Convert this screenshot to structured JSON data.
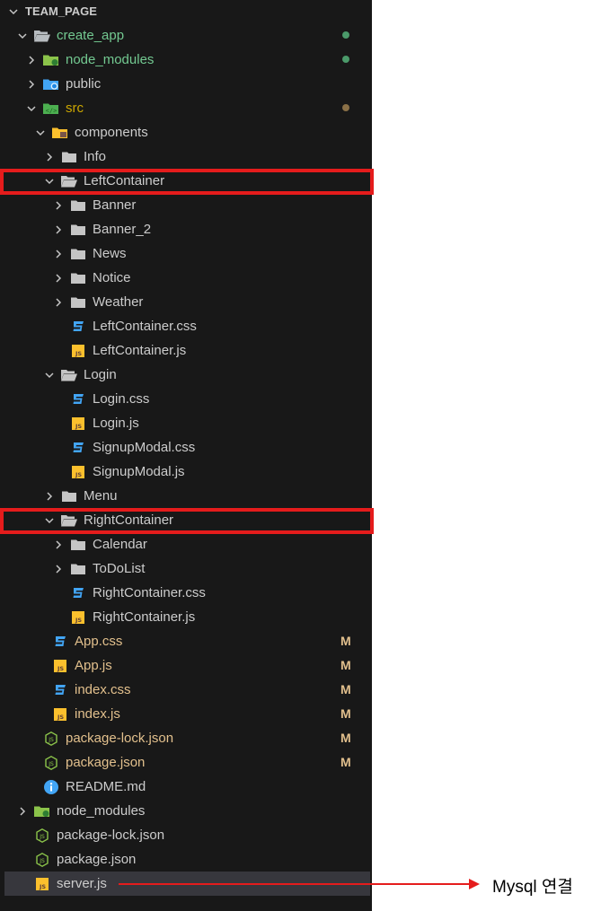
{
  "explorer": {
    "rows": [
      {
        "label": "TEAM_PAGE",
        "depth": 0,
        "chevron": "open",
        "icon": "none",
        "style": "root"
      },
      {
        "label": "create_app",
        "depth": 1,
        "chevron": "open",
        "icon": "folder-open-gray",
        "style": "green",
        "dot": "#4b9a6a"
      },
      {
        "label": "node_modules",
        "depth": 2,
        "chevron": "closed",
        "icon": "folder-node",
        "style": "green",
        "dot": "#4b9a6a"
      },
      {
        "label": "public",
        "depth": 2,
        "chevron": "closed",
        "icon": "folder-public",
        "style": "normal"
      },
      {
        "label": "src",
        "depth": 2,
        "chevron": "open",
        "icon": "folder-src",
        "style": "brown",
        "dot": "#8a7047"
      },
      {
        "label": "components",
        "depth": 3,
        "chevron": "open",
        "icon": "folder-components",
        "style": "normal"
      },
      {
        "label": "Info",
        "depth": 4,
        "chevron": "closed",
        "icon": "folder",
        "style": "normal"
      },
      {
        "label": "LeftContainer",
        "depth": 4,
        "chevron": "open",
        "icon": "folder-open",
        "style": "normal"
      },
      {
        "label": "Banner",
        "depth": 5,
        "chevron": "closed",
        "icon": "folder",
        "style": "normal"
      },
      {
        "label": "Banner_2",
        "depth": 5,
        "chevron": "closed",
        "icon": "folder",
        "style": "normal"
      },
      {
        "label": "News",
        "depth": 5,
        "chevron": "closed",
        "icon": "folder",
        "style": "normal"
      },
      {
        "label": "Notice",
        "depth": 5,
        "chevron": "closed",
        "icon": "folder",
        "style": "normal"
      },
      {
        "label": "Weather",
        "depth": 5,
        "chevron": "closed",
        "icon": "folder",
        "style": "normal"
      },
      {
        "label": "LeftContainer.css",
        "depth": 5,
        "chevron": "none",
        "icon": "css",
        "style": "normal"
      },
      {
        "label": "LeftContainer.js",
        "depth": 5,
        "chevron": "none",
        "icon": "js",
        "style": "normal"
      },
      {
        "label": "Login",
        "depth": 4,
        "chevron": "open",
        "icon": "folder-open",
        "style": "normal"
      },
      {
        "label": "Login.css",
        "depth": 5,
        "chevron": "none",
        "icon": "css",
        "style": "normal"
      },
      {
        "label": "Login.js",
        "depth": 5,
        "chevron": "none",
        "icon": "js",
        "style": "normal"
      },
      {
        "label": "SignupModal.css",
        "depth": 5,
        "chevron": "none",
        "icon": "css",
        "style": "normal"
      },
      {
        "label": "SignupModal.js",
        "depth": 5,
        "chevron": "none",
        "icon": "js",
        "style": "normal"
      },
      {
        "label": "Menu",
        "depth": 4,
        "chevron": "closed",
        "icon": "folder",
        "style": "normal"
      },
      {
        "label": "RightContainer",
        "depth": 4,
        "chevron": "open",
        "icon": "folder-open",
        "style": "normal"
      },
      {
        "label": "Calendar",
        "depth": 5,
        "chevron": "closed",
        "icon": "folder",
        "style": "normal"
      },
      {
        "label": "ToDoList",
        "depth": 5,
        "chevron": "closed",
        "icon": "folder",
        "style": "normal"
      },
      {
        "label": "RightContainer.css",
        "depth": 5,
        "chevron": "none",
        "icon": "css",
        "style": "normal"
      },
      {
        "label": "RightContainer.js",
        "depth": 5,
        "chevron": "none",
        "icon": "js",
        "style": "normal"
      },
      {
        "label": "App.css",
        "depth": 3,
        "chevron": "none",
        "icon": "css",
        "style": "mod",
        "badge": "M"
      },
      {
        "label": "App.js",
        "depth": 3,
        "chevron": "none",
        "icon": "js",
        "style": "mod",
        "badge": "M"
      },
      {
        "label": "index.css",
        "depth": 3,
        "chevron": "none",
        "icon": "css",
        "style": "mod",
        "badge": "M"
      },
      {
        "label": "index.js",
        "depth": 3,
        "chevron": "none",
        "icon": "js",
        "style": "mod",
        "badge": "M"
      },
      {
        "label": "package-lock.json",
        "depth": 2,
        "chevron": "none",
        "icon": "json",
        "style": "mod",
        "badge": "M"
      },
      {
        "label": "package.json",
        "depth": 2,
        "chevron": "none",
        "icon": "json",
        "style": "mod",
        "badge": "M"
      },
      {
        "label": "README.md",
        "depth": 2,
        "chevron": "none",
        "icon": "info",
        "style": "normal"
      },
      {
        "label": "node_modules",
        "depth": 1,
        "chevron": "closed",
        "icon": "folder-node",
        "style": "normal"
      },
      {
        "label": "package-lock.json",
        "depth": 1,
        "chevron": "none",
        "icon": "json",
        "style": "normal"
      },
      {
        "label": "package.json",
        "depth": 1,
        "chevron": "none",
        "icon": "json",
        "style": "normal"
      },
      {
        "label": "server.js",
        "depth": 1,
        "chevron": "none",
        "icon": "js",
        "style": "normal",
        "selected": true
      }
    ]
  },
  "highlights": [
    "LeftContainer",
    "RightContainer"
  ],
  "annotation": {
    "text": "Mysql 연결",
    "target": "server.js",
    "color": "#e51c1c"
  },
  "colors": {
    "background": "#181818",
    "highlight": "#e51c1c",
    "modified": "#e2c08d",
    "untracked": "#73c991"
  }
}
